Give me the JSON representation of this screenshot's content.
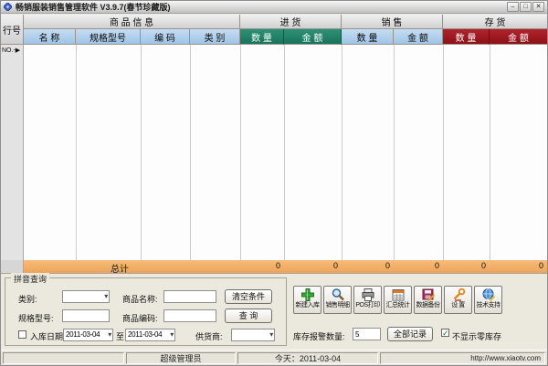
{
  "window": {
    "title": "畅销服装销售管理软件 V3.9.7(春节珍藏版)",
    "min_glyph": "–",
    "max_glyph": "□",
    "close_glyph": "✕"
  },
  "colors": {
    "purchase_header": "#1f8a6e",
    "sales_header": "#a9cde9",
    "stock_header": "#9c1720",
    "total_row": "#f1ae65"
  },
  "table": {
    "row_header_label": "行号",
    "groups": [
      "商 品 信 息",
      "进 货",
      "销 售",
      "存 货"
    ],
    "columns": [
      "名 称",
      "规格型号",
      "编 码",
      "类 别",
      "数 量",
      "金 额",
      "数 量",
      "金 额",
      "数 量",
      "金 额"
    ],
    "first_row_marker": "NO.-▶",
    "total_row": {
      "label": "总计",
      "values": [
        "0",
        "0",
        "0",
        "0",
        "0",
        "0"
      ]
    }
  },
  "query_panel": {
    "title": "拼音查询",
    "category_label": "类别:",
    "product_name_label": "商品名称:",
    "clear_button": "清空条件",
    "spec_label": "规格型号:",
    "code_label": "商品编码:",
    "query_button": "查 询",
    "date_checkbox_label": "入库日期:",
    "date_from": "2011-03-04",
    "to_label": "至",
    "date_to": "2011-03-04",
    "supplier_label": "供货商:",
    "dropdown_arrow": "▾"
  },
  "toolbar": {
    "buttons": [
      {
        "label": "新建入库",
        "icon": "plus-icon"
      },
      {
        "label": "销售明细",
        "icon": "magnifier-icon"
      },
      {
        "label": "POS打印",
        "icon": "printer-icon"
      },
      {
        "label": "汇总统计",
        "icon": "calculator-icon"
      },
      {
        "label": "数据备份",
        "icon": "backup-disk-icon"
      },
      {
        "label": "设 置",
        "icon": "wrench-icon"
      },
      {
        "label": "技术支持",
        "icon": "globe-icon"
      }
    ]
  },
  "stock_alert": {
    "label": "库存报警数量:",
    "value": "5",
    "all_records_button": "全部记录",
    "checkbox_label": "不显示零库存",
    "checkbox_checked": true,
    "check_glyph": "✓"
  },
  "status_bar": {
    "user": "超级管理员",
    "today": "今天：2011-03-04",
    "url": "http://www.xiaotv.com"
  }
}
